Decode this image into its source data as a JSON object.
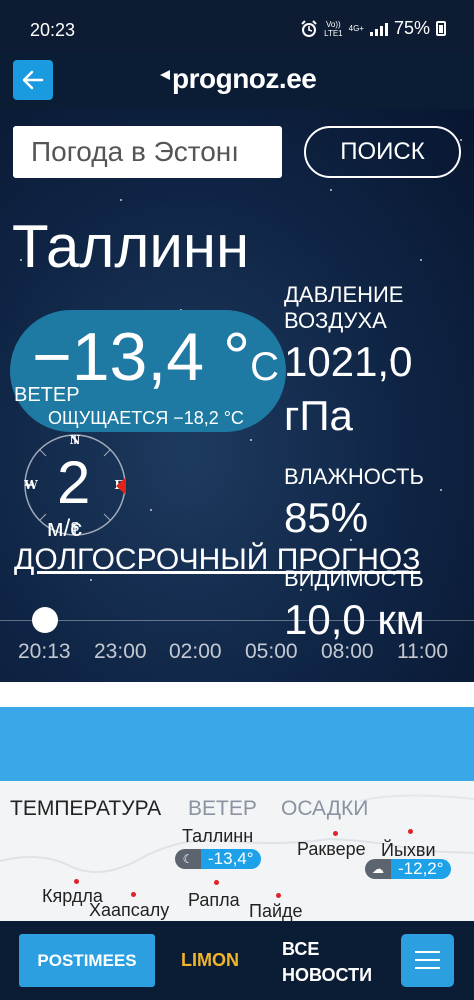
{
  "status_bar": {
    "time": "20:23",
    "network_top": "Vo))",
    "network_bottom": "LTE1",
    "data": "4G+",
    "battery": "75%"
  },
  "header": {
    "logo": "prognoz.ee"
  },
  "search": {
    "placeholder": "Погода в Эстонии",
    "value": "Погода в Эстонı",
    "button": "ПОИСК"
  },
  "weather": {
    "city": "Таллинн",
    "temperature": "−13,4 °",
    "temperature_unit": "C",
    "wind_label": "ВЕТЕР",
    "feels_like": "ОЩУЩАЕТСЯ −18,2 °C",
    "wind_speed": "2",
    "wind_unit": "м/с",
    "compass": {
      "n": "N",
      "s": "S",
      "e": "E",
      "w": "W"
    },
    "pressure_label": "ДАВЛЕНИЕ ВОЗДУХА",
    "pressure_value": "1021,0",
    "pressure_unit": "гПа",
    "humidity_label": "ВЛАЖНОСТЬ",
    "humidity_value": "85%",
    "visibility_label": "ВИДИМОСТЬ",
    "visibility_value": "10,0 км",
    "long_term_link": "ДОЛГОСРОЧНЫЙ ПРОГНОЗ"
  },
  "timeline": {
    "hours": [
      "20:13",
      "23:00",
      "02:00",
      "05:00",
      "08:00",
      "11:00"
    ]
  },
  "map": {
    "tabs": [
      "ТЕМПЕРАТУРА",
      "ВЕТЕР",
      "ОСАДКИ"
    ],
    "places": {
      "tallinn": "Таллинн",
      "rakvere": "Раквере",
      "johvi": "Йыхви",
      "kardla": "Кярдла",
      "haapsalu": "Хаапсалу",
      "rapla": "Рапла",
      "paide": "Пайде"
    },
    "badges": {
      "tallinn": "-13,4°",
      "johvi": "-12,2°"
    },
    "badge_icons": {
      "tallinn": "moon-icon",
      "johvi": "cloud-icon"
    }
  },
  "bottom_nav": {
    "postimees": "POSTIMEES",
    "limon": "LIMON",
    "news_line1": "ВСЕ",
    "news_line2": "НОВОСТИ"
  },
  "colors": {
    "accent": "#1a9be0",
    "header_bg": "#0b1d35",
    "temp_pill": "#1f7aa3",
    "limon": "#f1b52b"
  }
}
